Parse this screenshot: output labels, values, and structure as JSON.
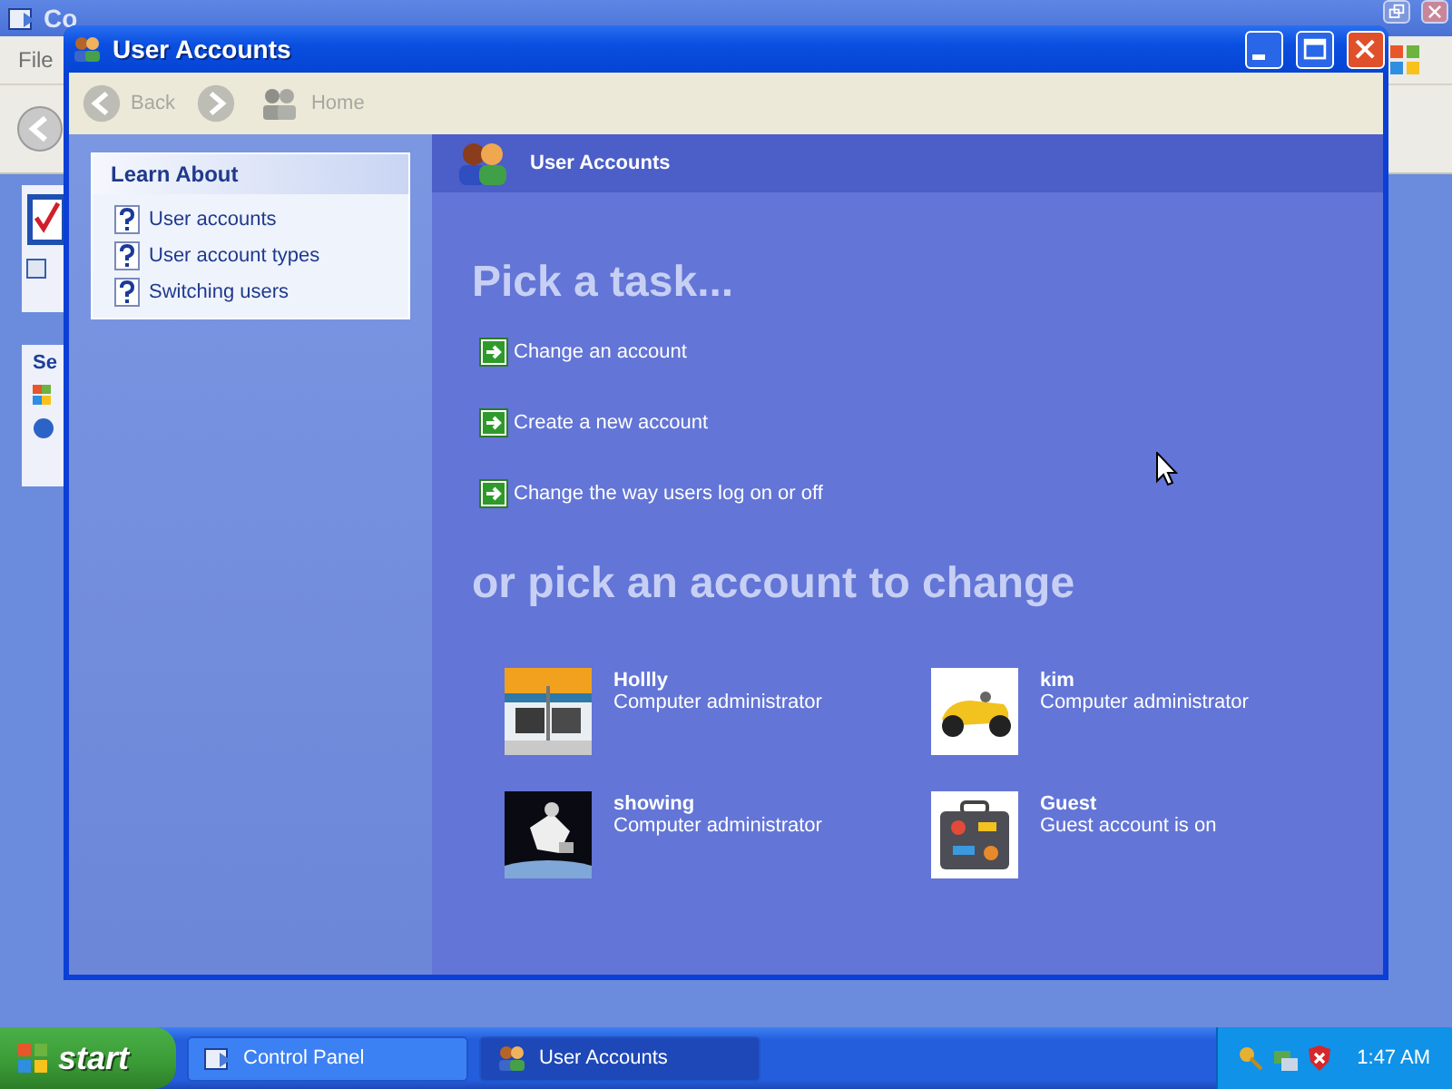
{
  "background_window": {
    "title": "Co",
    "menu": [
      "File"
    ],
    "panel_title": "Se"
  },
  "window": {
    "title": "User Accounts"
  },
  "toolbar": [
    {
      "kind": "back",
      "label": "Back",
      "disabled": true
    },
    {
      "kind": "forward",
      "disabled": true
    },
    {
      "kind": "home",
      "label": "Home",
      "disabled": true
    }
  ],
  "sidebar": {
    "title": "Learn About",
    "items": [
      "User accounts",
      "User account types",
      "Switching users"
    ]
  },
  "header": {
    "title": "User Accounts"
  },
  "tasks": {
    "heading": "Pick a task...",
    "items": [
      "Change an account",
      "Create a new account",
      "Change the way users log on or off"
    ]
  },
  "accounts": {
    "heading": "or pick an account to change",
    "items": [
      {
        "name": "Hollly",
        "type": "Computer administrator"
      },
      {
        "name": "kim",
        "type": "Computer administrator"
      },
      {
        "name": "showing",
        "type": "Computer administrator"
      },
      {
        "name": "Guest",
        "type": "Guest account is on"
      }
    ]
  },
  "taskbar": {
    "start": "start",
    "tasks": [
      {
        "label": "Control Panel",
        "selected": false
      },
      {
        "label": "User Accounts",
        "selected": true
      }
    ],
    "clock": "1:47 AM"
  }
}
